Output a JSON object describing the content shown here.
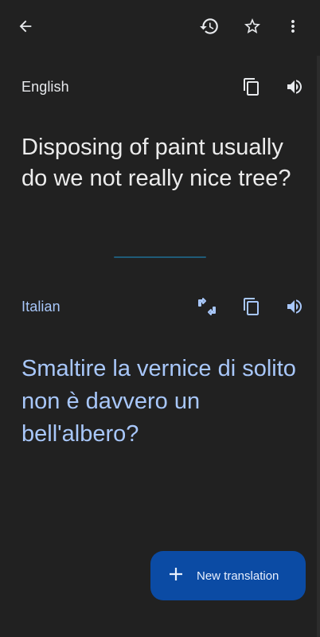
{
  "app_bar": {
    "back_icon": "arrow-back-icon",
    "history_icon": "history-icon",
    "favorite_icon": "star-outline-icon",
    "more_icon": "more-vert-icon"
  },
  "source": {
    "language": "English",
    "text": "Disposing of paint usually do we not really nice tree?",
    "copy_icon": "copy-icon",
    "speak_icon": "volume-icon"
  },
  "target": {
    "language": "Italian",
    "text": "Smaltire la vernice di solito non è davvero un bell'albero?",
    "alternatives_icon": "translate-alternatives-icon",
    "copy_icon": "copy-icon",
    "speak_icon": "volume-icon"
  },
  "fab": {
    "label": "New translation",
    "icon": "plus-icon"
  },
  "colors": {
    "background": "#212121",
    "accent_text": "#a8c7fa",
    "fab_background": "#0b4ba4",
    "divider": "#1f5b78"
  }
}
